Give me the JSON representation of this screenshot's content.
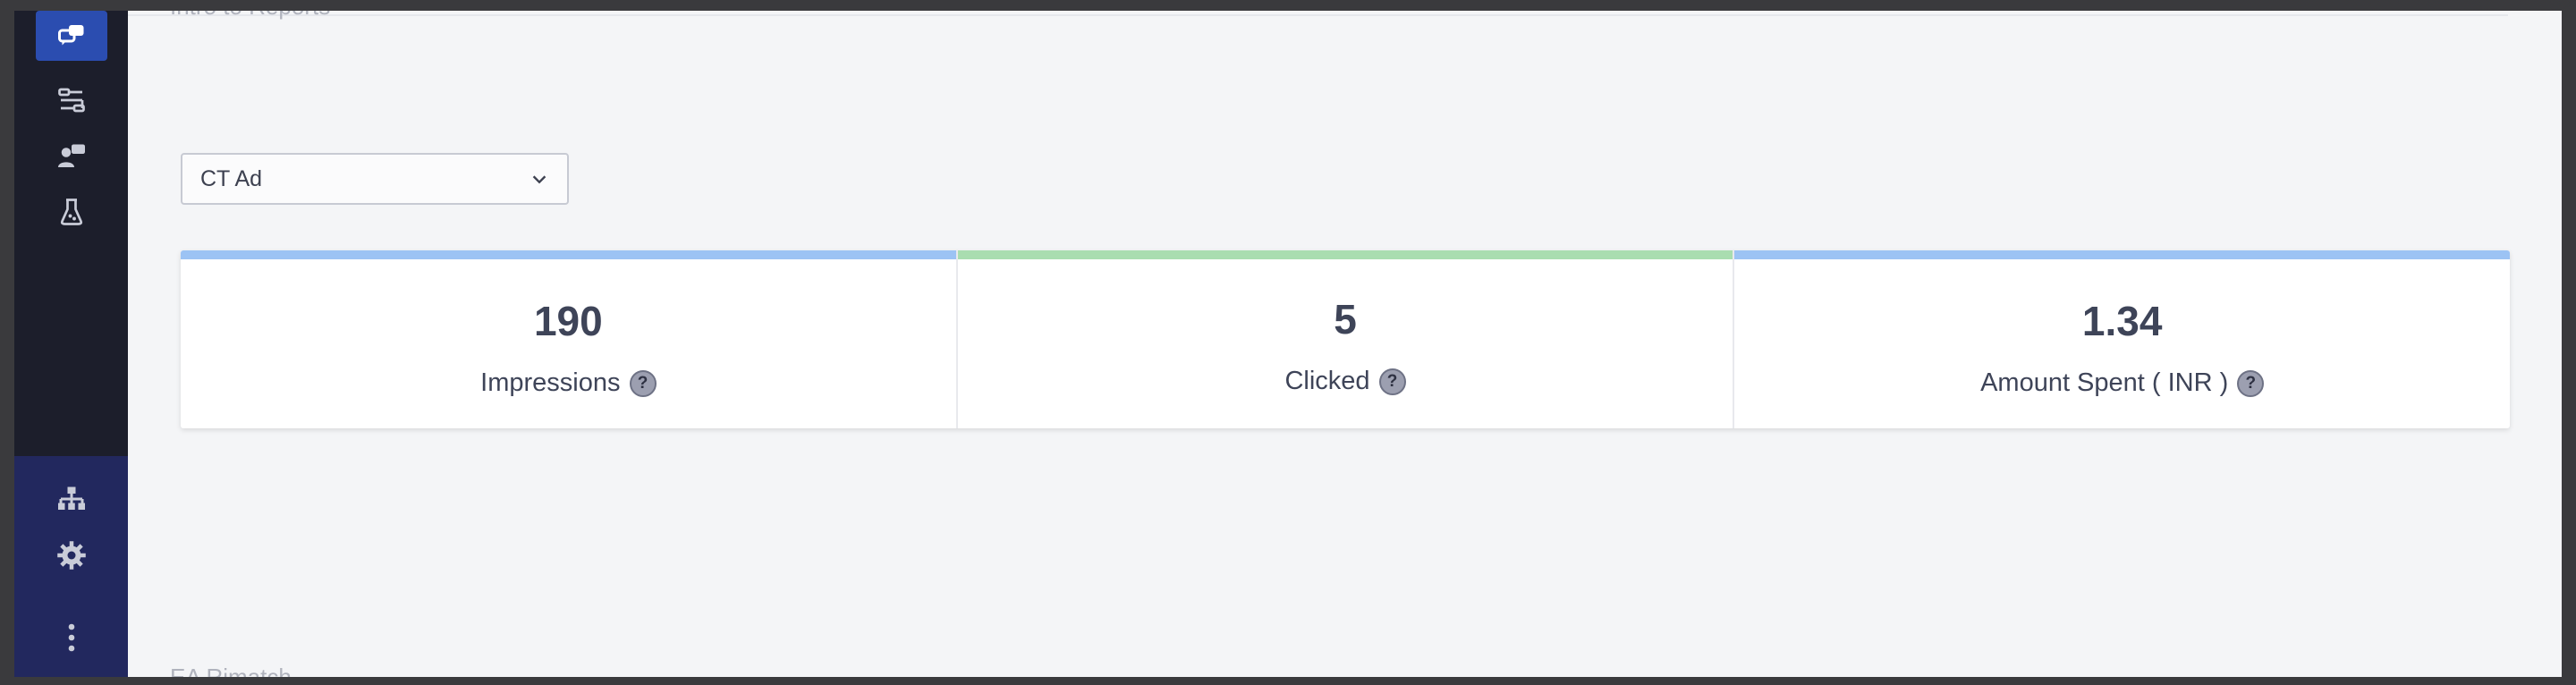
{
  "background": {
    "top_heading": "Intro to Reports",
    "bottom_text": "EA Rimatch"
  },
  "filter": {
    "selected": "CT Ad"
  },
  "stats": [
    {
      "value": "190",
      "label": "Impressions",
      "help": "?",
      "color": "#9cc3f4"
    },
    {
      "value": "5",
      "label": "Clicked",
      "help": "?",
      "color": "#a9ddb0"
    },
    {
      "value": "1.34",
      "label": "Amount Spent ( INR )",
      "help": "?",
      "color": "#9cc3f4"
    }
  ],
  "sidebar": {
    "top_icons": [
      "chat-bubbles-icon",
      "flow-icon",
      "user-message-icon",
      "experiment-flask-icon"
    ],
    "bottom_icons": [
      "hierarchy-icon",
      "settings-gear-icon",
      "more-vertical-icon"
    ],
    "active_color": "#2b4db0"
  }
}
